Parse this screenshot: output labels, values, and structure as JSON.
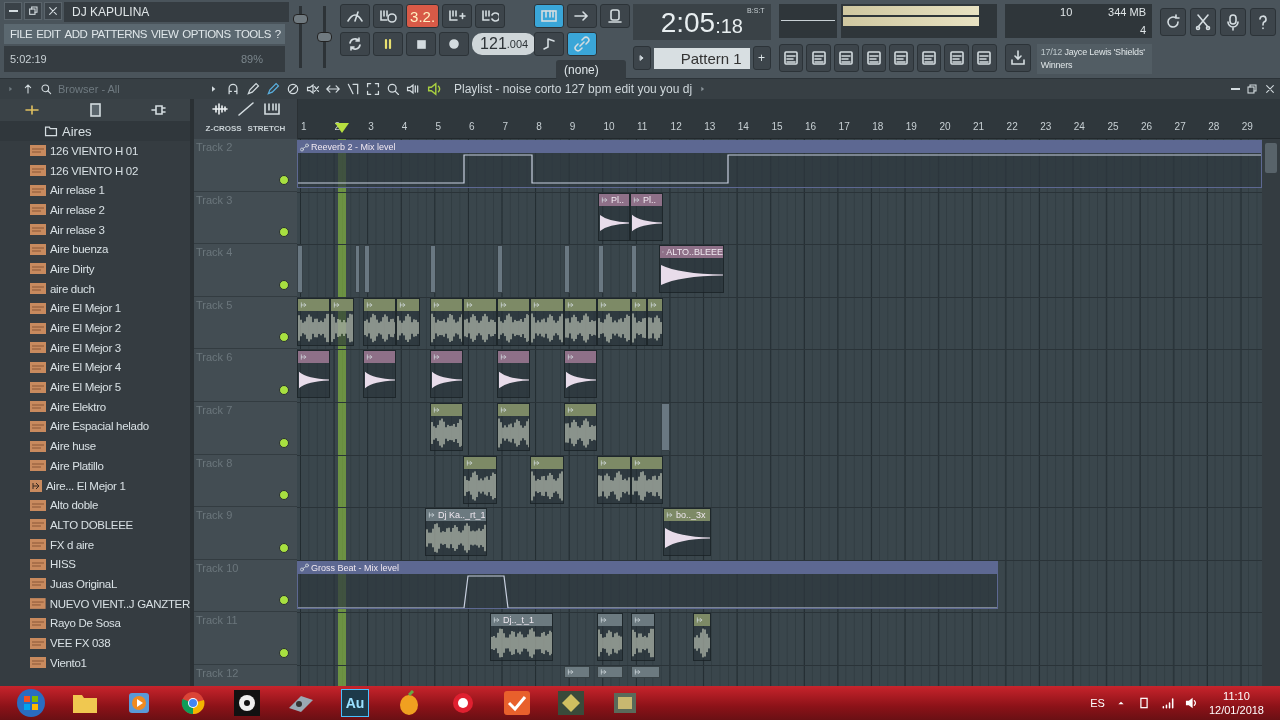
{
  "window": {
    "title": "DJ KAPULINA"
  },
  "menu": [
    "FILE",
    "EDIT",
    "ADD",
    "PATTERNS",
    "VIEW",
    "OPTIONS",
    "TOOLS",
    "?"
  ],
  "mixer": {
    "volume": {
      "level": 0.85
    },
    "pitch": {
      "level": 0.5
    }
  },
  "hint_bar": {
    "time": "5:02:19",
    "cpu": "89%"
  },
  "transport": {
    "playing": true,
    "tempo": "121",
    "tempo_fraction": ".004",
    "countdown_label": "3.2.",
    "countdown_on": true,
    "snap": "(none)"
  },
  "clock": {
    "main": "2:05",
    "seconds": ":18",
    "mode": "B:S:T"
  },
  "pattern": {
    "name": "Pattern 1",
    "add": "+"
  },
  "meters": {
    "polyphony": "10",
    "memory": "344 MB",
    "cores": "4"
  },
  "hint_panel": {
    "index": "17/12",
    "title": "Jayce Lewis 'Shields'",
    "subtitle": "Winners"
  },
  "browser": {
    "title": "Browser - All",
    "folder": "Aires",
    "items": [
      {
        "name": "126 VIENTO H 01",
        "kind": "audio"
      },
      {
        "name": "126 VIENTO H 02",
        "kind": "audio"
      },
      {
        "name": "Air relase 1",
        "kind": "audio"
      },
      {
        "name": "Air relase 2",
        "kind": "audio"
      },
      {
        "name": "Air relase 3",
        "kind": "audio"
      },
      {
        "name": "Aire buenza",
        "kind": "audio"
      },
      {
        "name": "Aire Dirty",
        "kind": "audio"
      },
      {
        "name": "aire duch",
        "kind": "audio"
      },
      {
        "name": "Aire El Mejor 1",
        "kind": "audio"
      },
      {
        "name": "Aire El Mejor 2",
        "kind": "audio"
      },
      {
        "name": "Aire El Mejor 3",
        "kind": "audio"
      },
      {
        "name": "Aire El Mejor 4",
        "kind": "audio"
      },
      {
        "name": "Aire El Mejor 5",
        "kind": "audio"
      },
      {
        "name": "Aire Elektro",
        "kind": "audio"
      },
      {
        "name": "Aire Espacial helado",
        "kind": "audio"
      },
      {
        "name": "Aire huse",
        "kind": "audio"
      },
      {
        "name": "Aire Platillo",
        "kind": "audio"
      },
      {
        "name": "Aire... El Mejor 1",
        "kind": "clip"
      },
      {
        "name": "Alto doble",
        "kind": "audio"
      },
      {
        "name": "ALTO DOBLEEE",
        "kind": "audio"
      },
      {
        "name": "FX d aire",
        "kind": "audio"
      },
      {
        "name": "HISS",
        "kind": "audio"
      },
      {
        "name": "Juas OriginaL",
        "kind": "audio"
      },
      {
        "name": "NUEVO VIENT..J GANZTER",
        "kind": "audio"
      },
      {
        "name": "Rayo De Sosa",
        "kind": "audio"
      },
      {
        "name": "VEE FX 038",
        "kind": "audio"
      },
      {
        "name": "Viento1",
        "kind": "audio"
      }
    ]
  },
  "playlist": {
    "title": "Playlist - noise corto 127 bpm edit you you dj",
    "crossfade": "Z-CROSS",
    "stretch": "STRETCH",
    "bars": [
      "1",
      "2",
      "3",
      "4",
      "5",
      "6",
      "7",
      "8",
      "9",
      "10",
      "11",
      "12",
      "13",
      "14",
      "15",
      "16",
      "17",
      "18",
      "19",
      "20",
      "21",
      "22",
      "23",
      "24",
      "25",
      "26",
      "27",
      "28",
      "29"
    ],
    "tracks": [
      {
        "name": "Track 2",
        "enabled": true,
        "clips": [
          {
            "kind": "automation",
            "label": "Reeverb 2 - Mix level",
            "color": "#5d6892"
          }
        ]
      },
      {
        "name": "Track 3",
        "enabled": true,
        "clips": [
          {
            "kind": "shot",
            "label": "Pl..",
            "color": "#8e7088"
          },
          {
            "kind": "shot",
            "label": "Pl..",
            "color": "#8e7088"
          }
        ]
      },
      {
        "name": "Track 4",
        "enabled": true,
        "clips": [
          {
            "kind": "slice",
            "color": "#6a7882"
          },
          {
            "kind": "slice",
            "color": "#6a7882"
          },
          {
            "kind": "slice",
            "color": "#6a7882"
          },
          {
            "kind": "slice",
            "color": "#6a7882"
          },
          {
            "kind": "slice",
            "color": "#6a7882"
          },
          {
            "kind": "slice",
            "color": "#6a7882"
          },
          {
            "kind": "slice",
            "color": "#6a7882"
          },
          {
            "kind": "slice",
            "color": "#6a7882"
          },
          {
            "kind": "shot",
            "label": "ALTO..BLEEE",
            "color": "#8e7088"
          }
        ]
      },
      {
        "name": "Track 5",
        "enabled": true,
        "clips": [
          {
            "kind": "loop",
            "color": "#7d8a66"
          },
          {
            "kind": "loop",
            "color": "#7d8a66"
          },
          {
            "kind": "loop",
            "color": "#7d8a66"
          },
          {
            "kind": "loop",
            "color": "#7d8a66"
          },
          {
            "kind": "loop",
            "color": "#7d8a66"
          },
          {
            "kind": "loop",
            "color": "#7d8a66"
          },
          {
            "kind": "loop",
            "color": "#7d8a66"
          },
          {
            "kind": "loop",
            "color": "#7d8a66"
          },
          {
            "kind": "loop",
            "color": "#7d8a66"
          },
          {
            "kind": "loop",
            "color": "#7d8a66"
          },
          {
            "kind": "loop",
            "color": "#7d8a66"
          },
          {
            "kind": "loop",
            "color": "#7d8a66"
          }
        ]
      },
      {
        "name": "Track 6",
        "enabled": true,
        "clips": [
          {
            "kind": "shot",
            "color": "#8e7088"
          },
          {
            "kind": "shot",
            "color": "#8e7088"
          },
          {
            "kind": "shot",
            "color": "#8e7088"
          },
          {
            "kind": "shot",
            "color": "#8e7088"
          },
          {
            "kind": "shot",
            "color": "#8e7088"
          }
        ]
      },
      {
        "name": "Track 7",
        "enabled": true,
        "clips": [
          {
            "kind": "loop",
            "color": "#7d8a66"
          },
          {
            "kind": "loop",
            "color": "#7d8a66"
          },
          {
            "kind": "loop",
            "color": "#7d8a66"
          },
          {
            "kind": "slice",
            "color": "#6a7882"
          }
        ]
      },
      {
        "name": "Track 8",
        "enabled": true,
        "clips": [
          {
            "kind": "loop",
            "color": "#7d8a66"
          },
          {
            "kind": "loop",
            "color": "#7d8a66"
          },
          {
            "kind": "loop",
            "color": "#7d8a66"
          },
          {
            "kind": "loop",
            "color": "#7d8a66"
          }
        ]
      },
      {
        "name": "Track 9",
        "enabled": true,
        "clips": [
          {
            "kind": "loop",
            "label": "Dj Ka.._rt_1",
            "color": "#6c7a80"
          },
          {
            "kind": "shot",
            "label": "bo.._3x",
            "color": "#7d8a66"
          }
        ]
      },
      {
        "name": "Track 10",
        "enabled": true,
        "clips": [
          {
            "kind": "automation",
            "label": "Gross Beat - Mix level",
            "color": "#5d6892"
          }
        ]
      },
      {
        "name": "Track 11",
        "enabled": true,
        "clips": [
          {
            "kind": "loop",
            "label": "Dj.._t_1",
            "color": "#6c7a80"
          },
          {
            "kind": "loop",
            "color": "#6c7a80"
          },
          {
            "kind": "loop",
            "color": "#6c7a80"
          },
          {
            "kind": "loop",
            "color": "#7d8a66"
          }
        ]
      },
      {
        "name": "Track 12",
        "clips": [
          {
            "kind": "stub",
            "color": "#6c7a80"
          },
          {
            "kind": "stub",
            "color": "#6c7a80"
          },
          {
            "kind": "stub",
            "color": "#6c7a80"
          }
        ]
      }
    ]
  },
  "taskbar": {
    "audition": "Au",
    "language": "ES",
    "time": "11:10",
    "date": "12/01/2018"
  }
}
